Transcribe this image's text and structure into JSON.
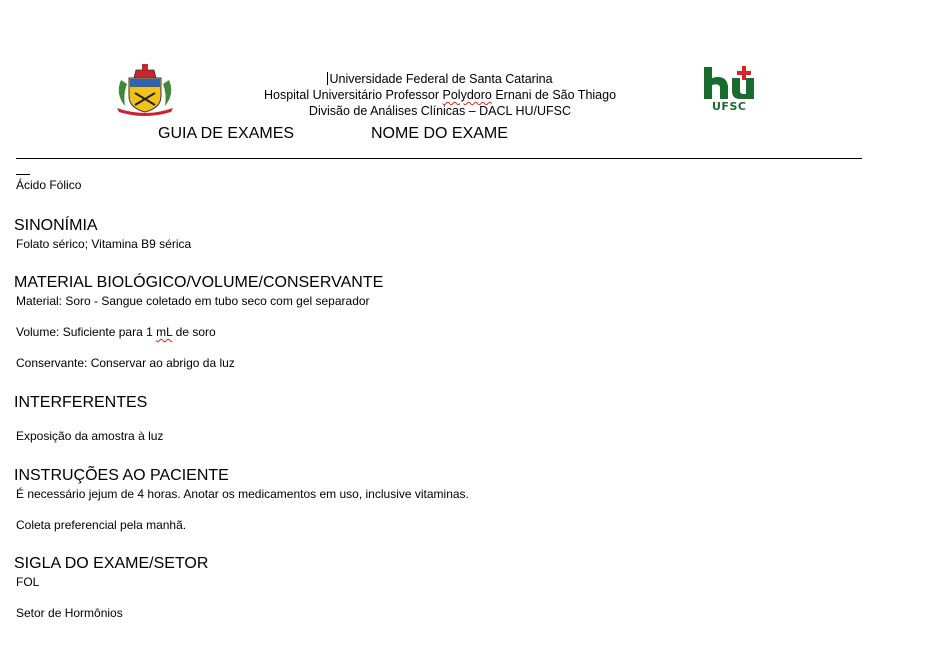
{
  "header": {
    "line1": "Universidade Federal de Santa Catarina",
    "line2_pre": "Hospital Universitário Professor ",
    "line2_mark": "Polydoro",
    "line2_post": " Ernani de São Thiago",
    "line3": "Divisão de Análises Clínicas – DACL HU/UFSC",
    "guide_label": "GUIA DE EXAMES",
    "exam_name_label": "NOME DO EXAME",
    "logo_right_top": "hu",
    "logo_right_bottom": "UFSC"
  },
  "exam": {
    "name": "Ácido Fólico"
  },
  "sections": {
    "sinonimia": {
      "title": "SINONÍMIA",
      "text": "Folato sérico; Vitamina B9 sérica"
    },
    "material": {
      "title": "MATERIAL BIOLÓGICO/VOLUME/CONSERVANTE",
      "material": "Material: Soro - Sangue coletado em tubo seco com gel separador",
      "volume_pre": "Volume: Suficiente para 1 ",
      "volume_mark": "mL",
      "volume_post": " de soro",
      "conservante": "Conservante: Conservar ao abrigo da luz"
    },
    "interferentes": {
      "title": "INTERFERENTES",
      "text": "Exposição da amostra à luz"
    },
    "instrucoes": {
      "title": "INSTRUÇÕES AO PACIENTE",
      "line1": "É necessário jejum de 4 horas. Anotar os medicamentos em uso, inclusive vitaminas.",
      "line2": "Coleta preferencial pela manhã."
    },
    "sigla": {
      "title": "SIGLA DO EXAME/SETOR",
      "code": "FOL",
      "setor": "Setor de Hormônios"
    }
  },
  "colors": {
    "hu_green": "#1a6b2e",
    "hu_red": "#d8232a",
    "spell_underline": "#d22"
  }
}
